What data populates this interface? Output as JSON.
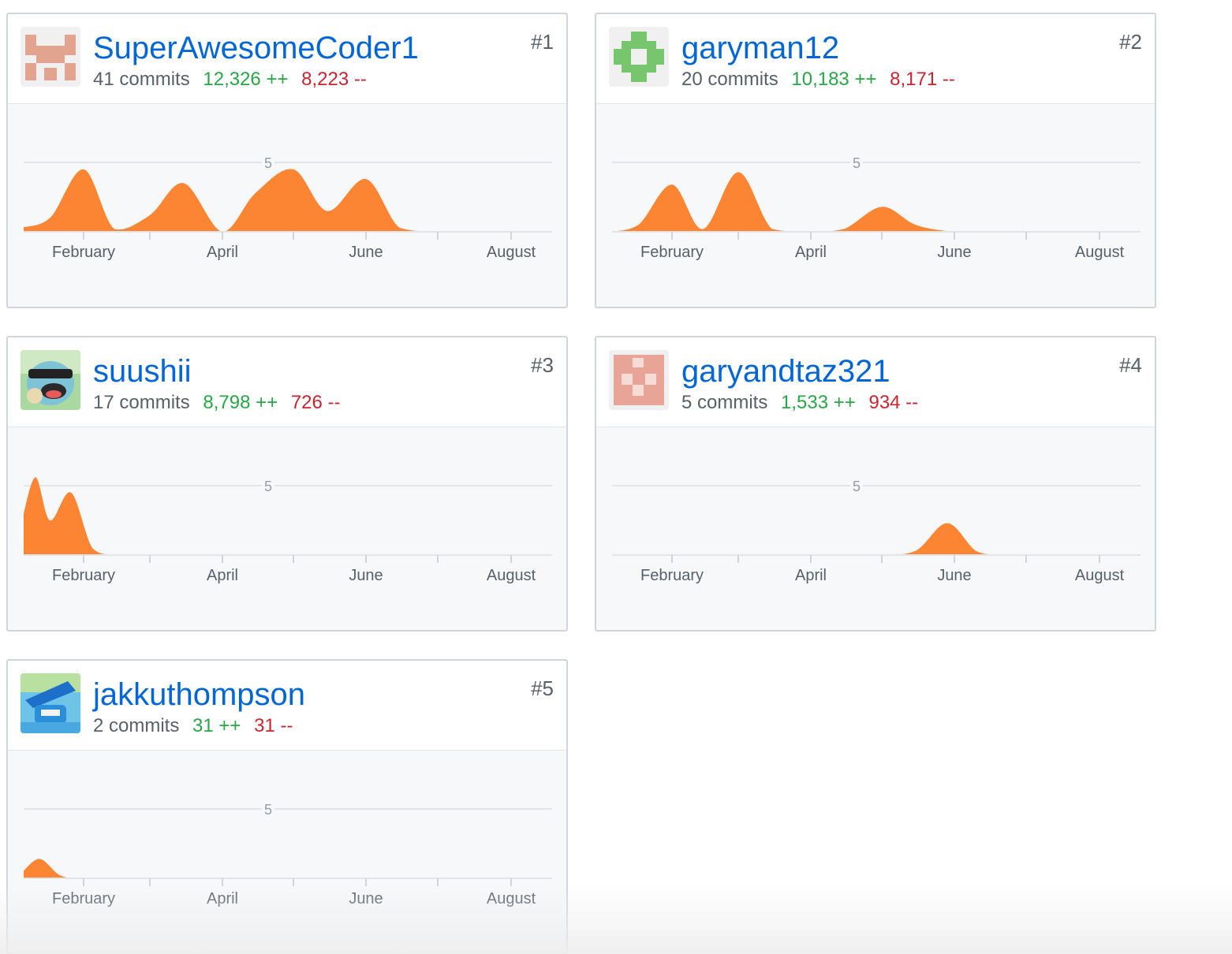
{
  "axis": {
    "months": [
      "February",
      "April",
      "June",
      "August"
    ],
    "y_tick_label": "5"
  },
  "colors": {
    "area": "#fb8532",
    "link": "#0366d6",
    "additions": "#28a745",
    "deletions": "#cb2431"
  },
  "contributors": [
    {
      "rank": "#1",
      "username": "SuperAwesomeCoder1",
      "commits": "41 commits",
      "additions": "12,326 ++",
      "deletions": "8,223 --",
      "avatar": "identicon-salmon-pattern"
    },
    {
      "rank": "#2",
      "username": "garyman12",
      "commits": "20 commits",
      "additions": "10,183 ++",
      "deletions": "8,171 --",
      "avatar": "identicon-green-cross"
    },
    {
      "rank": "#3",
      "username": "suushii",
      "commits": "17 commits",
      "additions": "8,798 ++",
      "deletions": "726 --",
      "avatar": "squirtle-photo"
    },
    {
      "rank": "#4",
      "username": "garyandtaz321",
      "commits": "5 commits",
      "additions": "1,533 ++",
      "deletions": "934 --",
      "avatar": "identicon-pink-pattern"
    },
    {
      "rank": "#5",
      "username": "jakkuthompson",
      "commits": "2 commits",
      "additions": "31 ++",
      "deletions": "31 --",
      "avatar": "blue-character-photo"
    }
  ],
  "chart_data": [
    {
      "type": "area",
      "contributor": "SuperAwesomeCoder1",
      "x_range": [
        "Jan",
        "Aug"
      ],
      "ylim": [
        0,
        7
      ],
      "grid_lines": [
        5
      ],
      "x": [
        "Jan 01",
        "Jan 15",
        "Feb 01",
        "Feb 15",
        "Mar 01",
        "Mar 15",
        "Apr 01",
        "Apr 15",
        "May 01",
        "May 15",
        "Jun 01",
        "Jun 15",
        "Jul 01",
        "Jul 15",
        "Aug 01",
        "Aug 15"
      ],
      "values": [
        0.3,
        1.0,
        4.5,
        0.2,
        1.2,
        3.5,
        0,
        2.8,
        4.5,
        1.5,
        3.8,
        0.3,
        0,
        0,
        0,
        0
      ]
    },
    {
      "type": "area",
      "contributor": "garyman12",
      "x_range": [
        "Jan",
        "Aug"
      ],
      "ylim": [
        0,
        7
      ],
      "grid_lines": [
        5
      ],
      "x": [
        "Jan 01",
        "Jan 15",
        "Feb 01",
        "Feb 15",
        "Mar 01",
        "Mar 15",
        "Apr 01",
        "Apr 15",
        "May 01",
        "May 15",
        "Jun 01",
        "Jun 15",
        "Jul 01",
        "Jul 15",
        "Aug 01",
        "Aug 15"
      ],
      "values": [
        0,
        0.5,
        3.4,
        0.2,
        4.3,
        0.2,
        0,
        0.2,
        1.8,
        0.5,
        0,
        0,
        0,
        0,
        0,
        0
      ]
    },
    {
      "type": "area",
      "contributor": "suushii",
      "x_range": [
        "Jan",
        "Aug"
      ],
      "ylim": [
        0,
        7
      ],
      "grid_lines": [
        5
      ],
      "x": [
        "Jan 01",
        "Jan 08",
        "Jan 15",
        "Jan 25",
        "Feb 05",
        "Feb 15",
        "Mar 01",
        "Apr 01",
        "May 01",
        "Jun 01",
        "Jul 01",
        "Aug 01",
        "Aug 15"
      ],
      "values": [
        2.0,
        5.6,
        2.5,
        4.5,
        0.5,
        0,
        0,
        0,
        0,
        0,
        0,
        0,
        0
      ]
    },
    {
      "type": "area",
      "contributor": "garyandtaz321",
      "x_range": [
        "Jan",
        "Aug"
      ],
      "ylim": [
        0,
        7
      ],
      "grid_lines": [
        5
      ],
      "x": [
        "Jan 01",
        "Feb 01",
        "Mar 01",
        "Apr 01",
        "May 01",
        "May 15",
        "May 28",
        "Jun 10",
        "Jun 20",
        "Jul 01",
        "Aug 01",
        "Aug 15"
      ],
      "values": [
        0,
        0,
        0,
        0,
        0,
        0.3,
        2.3,
        0.3,
        0,
        0,
        0,
        0
      ]
    },
    {
      "type": "area",
      "contributor": "jakkuthompson",
      "x_range": [
        "Jan",
        "Aug"
      ],
      "ylim": [
        0,
        7
      ],
      "grid_lines": [
        5
      ],
      "x": [
        "Jan 01",
        "Jan 10",
        "Jan 20",
        "Feb 01",
        "Mar 01",
        "Apr 01",
        "May 01",
        "Jun 01",
        "Jul 01",
        "Aug 01",
        "Aug 15"
      ],
      "values": [
        0.3,
        1.4,
        0.2,
        0,
        0,
        0,
        0,
        0,
        0,
        0,
        0
      ]
    }
  ]
}
